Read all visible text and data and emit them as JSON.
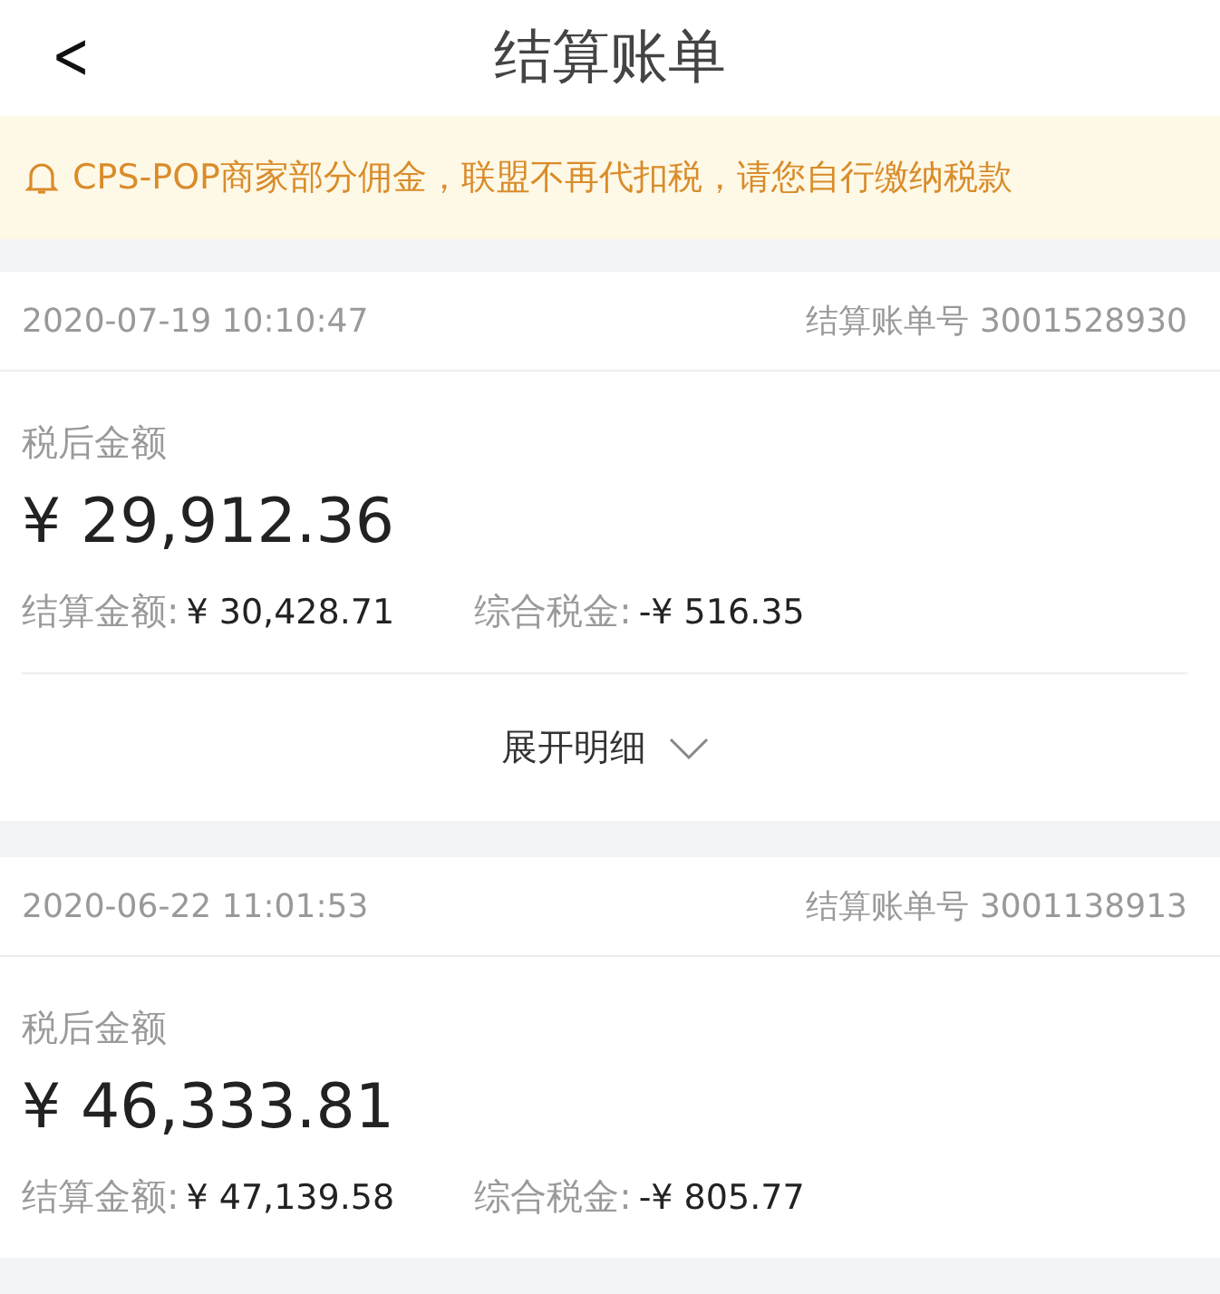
{
  "header": {
    "back": "<",
    "title": "结算账单"
  },
  "notice": {
    "text": "CPS-POP商家部分佣金，联盟不再代扣税，请您自行缴纳税款"
  },
  "bills": [
    {
      "time": "2020-07-19 10:10:47",
      "number_label": "结算账单号",
      "number": "3001528930",
      "amount_label": "税后金额",
      "amount": "¥ 29,912.36",
      "settle_label": "结算金额:",
      "settle": "¥ 30,428.71",
      "tax_label": "综合税金:",
      "tax": "-¥ 516.35",
      "expand": "展开明细"
    },
    {
      "time": "2020-06-22 11:01:53",
      "number_label": "结算账单号",
      "number": "3001138913",
      "amount_label": "税后金额",
      "amount": "¥ 46,333.81",
      "settle_label": "结算金额:",
      "settle": "¥ 47,139.58",
      "tax_label": "综合税金:",
      "tax": "-¥ 805.77"
    }
  ]
}
